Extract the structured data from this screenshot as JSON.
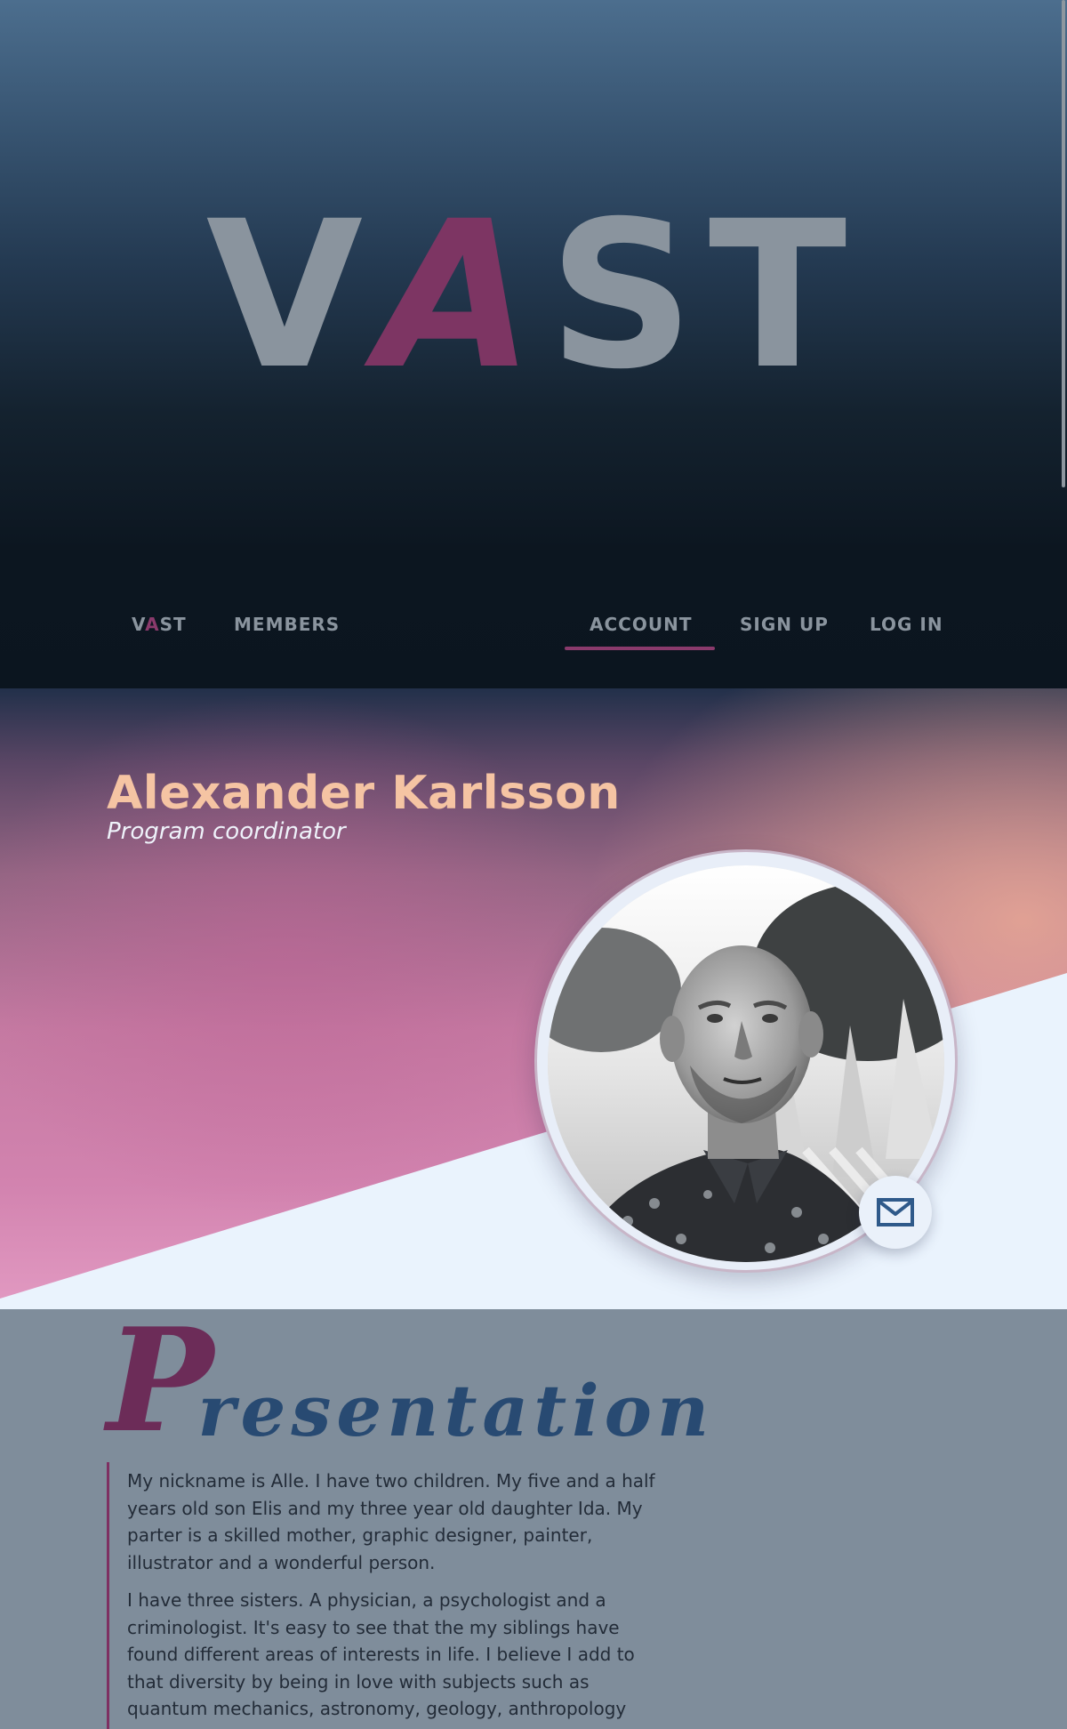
{
  "hero": {
    "logo_letter_1": "V",
    "logo_letter_2": "A",
    "logo_letter_rest": "ST"
  },
  "nav": {
    "brand_1": "V",
    "brand_2": "A",
    "brand_3": "ST",
    "members": "MEMBERS",
    "account": "ACCOUNT",
    "signup": "SIGN UP",
    "login": "LOG IN",
    "active_item": "ACCOUNT"
  },
  "profile": {
    "name": "Alexander Karlsson",
    "role": "Program coordinator",
    "avatar_icon": "person-photo",
    "contact_icon": "envelope-icon"
  },
  "presentation": {
    "title_initial": "P",
    "title_rest": "resentation",
    "paragraphs": [
      "My nickname is Alle. I have two children. My five and a half years old son Elis and my three year old daughter Ida. My parter is a skilled mother, graphic designer, painter, illustrator and a wonderful person.",
      "I have three sisters. A physician, a psychologist and a criminologist. It's easy to see that the my siblings have found different areas of interests in life. I believe I add to that diversity by being in love with subjects such as quantum mechanics, astronomy, geology, anthropology"
    ]
  },
  "colors": {
    "accent": "#7d3563",
    "name": "#f5c4a3",
    "title_blue": "#284a72",
    "nav_text": "#8a949e"
  }
}
